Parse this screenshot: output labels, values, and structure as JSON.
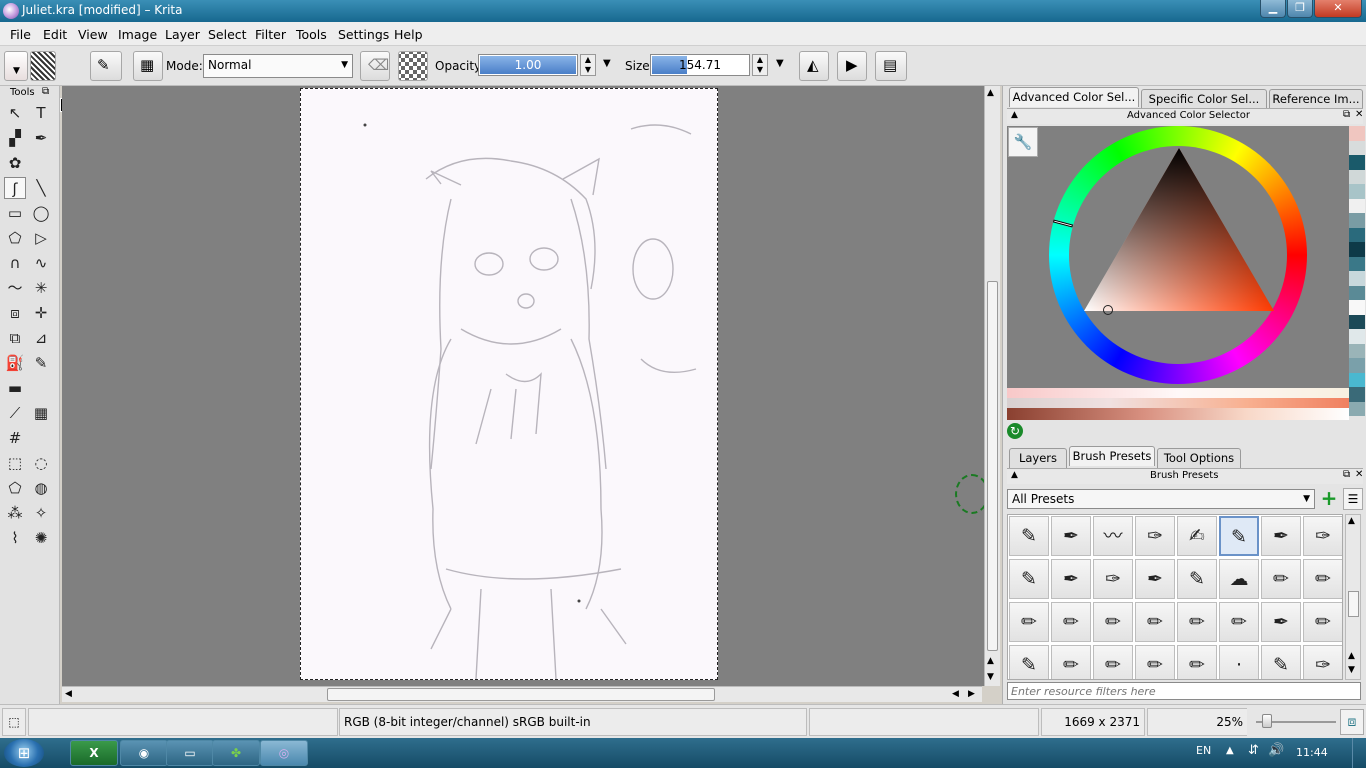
{
  "window": {
    "title": "Juliet.kra [modified] – Krita"
  },
  "menu": [
    "File",
    "Edit",
    "View",
    "Image",
    "Layer",
    "Select",
    "Filter",
    "Tools",
    "Settings",
    "Help"
  ],
  "toolbar": {
    "mode_label": "Mode:",
    "mode_value": "Normal",
    "opacity_label": "Opacity:",
    "opacity_value": "1.00",
    "opacity_fill": 1.0,
    "size_label": "Size:",
    "size_value": "154.71",
    "size_fill": 0.36
  },
  "toolbox": {
    "title": "Tools"
  },
  "tools": [
    {
      "name": "select-shapes-icon",
      "glyph": "↖"
    },
    {
      "name": "text-tool-icon",
      "glyph": "T"
    },
    {
      "name": "gradient-edit-icon",
      "glyph": "▞"
    },
    {
      "name": "calligraphy-icon",
      "glyph": "✒"
    },
    {
      "name": "multibrush-icon",
      "glyph": "✿"
    },
    {
      "name": "",
      "glyph": ""
    },
    {
      "name": "freehand-brush-icon",
      "glyph": "ʃ"
    },
    {
      "name": "line-tool-icon",
      "glyph": "╲"
    },
    {
      "name": "rectangle-tool-icon",
      "glyph": "▭"
    },
    {
      "name": "ellipse-tool-icon",
      "glyph": "◯"
    },
    {
      "name": "polygon-tool-icon",
      "glyph": "⬠"
    },
    {
      "name": "polyline-tool-icon",
      "glyph": "▷"
    },
    {
      "name": "bezier-tool-icon",
      "glyph": "∩"
    },
    {
      "name": "freehand-path-icon",
      "glyph": "∿"
    },
    {
      "name": "dynamic-brush-icon",
      "glyph": "〜"
    },
    {
      "name": "multi-brush-icon",
      "glyph": "✳"
    },
    {
      "name": "transform-tool-icon",
      "glyph": "⧈"
    },
    {
      "name": "move-tool-icon",
      "glyph": "✛"
    },
    {
      "name": "crop-tool-icon",
      "glyph": "⧉"
    },
    {
      "name": "measure-tool-icon",
      "glyph": "⊿"
    },
    {
      "name": "fill-tool-icon",
      "glyph": "⛽"
    },
    {
      "name": "color-picker-icon",
      "glyph": "✎"
    },
    {
      "name": "gradient-tool-icon",
      "glyph": "▬"
    },
    {
      "name": "",
      "glyph": ""
    },
    {
      "name": "ruler-assistant-icon",
      "glyph": "⟋"
    },
    {
      "name": "perspective-grid-icon",
      "glyph": "▦"
    },
    {
      "name": "grid-tool-icon",
      "glyph": "#"
    },
    {
      "name": "",
      "glyph": ""
    },
    {
      "name": "rect-select-icon",
      "glyph": "⬚"
    },
    {
      "name": "ellipse-select-icon",
      "glyph": "◌"
    },
    {
      "name": "polygon-select-icon",
      "glyph": "⬠"
    },
    {
      "name": "outline-select-icon",
      "glyph": "◍"
    },
    {
      "name": "contiguous-select-icon",
      "glyph": "⁂"
    },
    {
      "name": "magic-wand-icon",
      "glyph": "✧"
    },
    {
      "name": "bezier-select-icon",
      "glyph": "⌇"
    },
    {
      "name": "similar-select-icon",
      "glyph": "✺"
    }
  ],
  "dockers": {
    "top_tabs": [
      "Advanced Color Sel...",
      "Specific Color Sel...",
      "Reference Im..."
    ],
    "color_selector_title": "Advanced Color Selector",
    "bottom_tabs": [
      "Layers",
      "Brush Presets",
      "Tool Options"
    ],
    "brush_presets_title": "Brush Presets",
    "preset_filter": "All Presets",
    "resource_filter_placeholder": "Enter resource filters here"
  },
  "colors": {
    "palette": [
      "#f0c6c0",
      "#d8dcdc",
      "#1a5a6a",
      "#d0d8d8",
      "#a8c4c8",
      "#f0f0f0",
      "#7a9ca4",
      "#2a6a7c",
      "#0e3a48",
      "#3a7888",
      "#c8d8dc",
      "#5a8a96",
      "#f8f8f8",
      "#1c4a58",
      "#e0e8ea",
      "#9ab4b8",
      "#7aa0aa",
      "#4ab8d0",
      "#3a6a78",
      "#8aaab0"
    ]
  },
  "status": {
    "color_space": "RGB (8-bit integer/channel)  sRGB built-in",
    "dimensions": "1669 x 2371",
    "zoom": "25%"
  },
  "taskbar": {
    "lang": "EN",
    "time": "11:44"
  }
}
